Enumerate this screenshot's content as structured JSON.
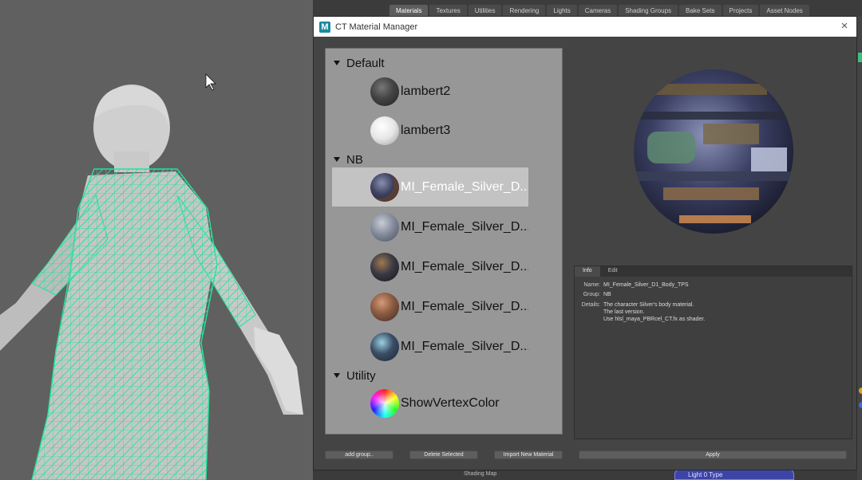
{
  "hypershade_tabs": [
    "Materials",
    "Textures",
    "Utilities",
    "Rendering",
    "Lights",
    "Cameras",
    "Shading Groups",
    "Bake Sets",
    "Projects",
    "Asset Nodes"
  ],
  "window": {
    "title": "CT Material Manager",
    "icon": "maya-m-icon",
    "close_icon": "×"
  },
  "groups": [
    {
      "name": "Default",
      "items": [
        {
          "label": "lambert2"
        },
        {
          "label": "lambert3"
        }
      ]
    },
    {
      "name": "NB",
      "items": [
        {
          "label": "MI_Female_Silver_D...",
          "selected": true
        },
        {
          "label": "MI_Female_Silver_D..."
        },
        {
          "label": "MI_Female_Silver_D..."
        },
        {
          "label": "MI_Female_Silver_D..."
        },
        {
          "label": "MI_Female_Silver_D..."
        }
      ]
    },
    {
      "name": "Utility",
      "items": [
        {
          "label": "ShowVertexColor"
        }
      ]
    }
  ],
  "info": {
    "tabs": [
      "Info",
      "Edit"
    ],
    "name_key": "Name:",
    "name": "MI_Female_Silver_D1_Body_TPS",
    "group_key": "Group:",
    "group": "NB",
    "details_key": "Details:",
    "details": [
      "The character Silver's body material.",
      "The last version.",
      "Use hlsl_maya_PBRcel_CT.fx as shader."
    ]
  },
  "buttons": {
    "add_group": "add group..",
    "delete_selected": "Delete Selected",
    "import_material": "Import New Material",
    "apply": "Apply"
  },
  "background": {
    "node_label": "Light 0 Type",
    "shading_map": "Shading Map"
  },
  "colors": {
    "wireframe": "#22e39a",
    "selection": "#c3c3c3",
    "list_bg": "#979797"
  }
}
